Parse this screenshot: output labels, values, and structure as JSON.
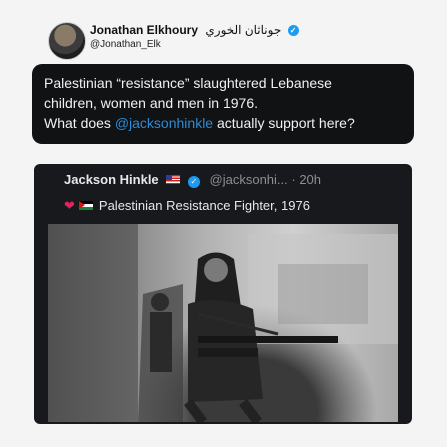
{
  "post": {
    "author_name": "Jonathan Elkhoury",
    "author_name_arabic": "جوناثان الخوري",
    "author_handle": "@Jonathan_Elk",
    "text_line1": "Palestinian “resistance” slaughtered Lebanese",
    "text_line2": "children, women and men in 1976.",
    "text_line3a": "What does ",
    "text_mention": "@jacksonhinkle",
    "text_line3b": " actually support here?"
  },
  "quoted": {
    "name": "Jackson Hinkle",
    "handle_time": "@jacksonhi... · 20h",
    "caption": "Palestinian Resistance Fighter, 1976"
  },
  "colors": {
    "verified": "#1d9bf0",
    "mention": "#2f8bd3",
    "heart": "#e0245e"
  },
  "icons": [
    "verified-badge-icon",
    "us-flag-icon",
    "heart-icon",
    "palestine-flag-icon"
  ]
}
